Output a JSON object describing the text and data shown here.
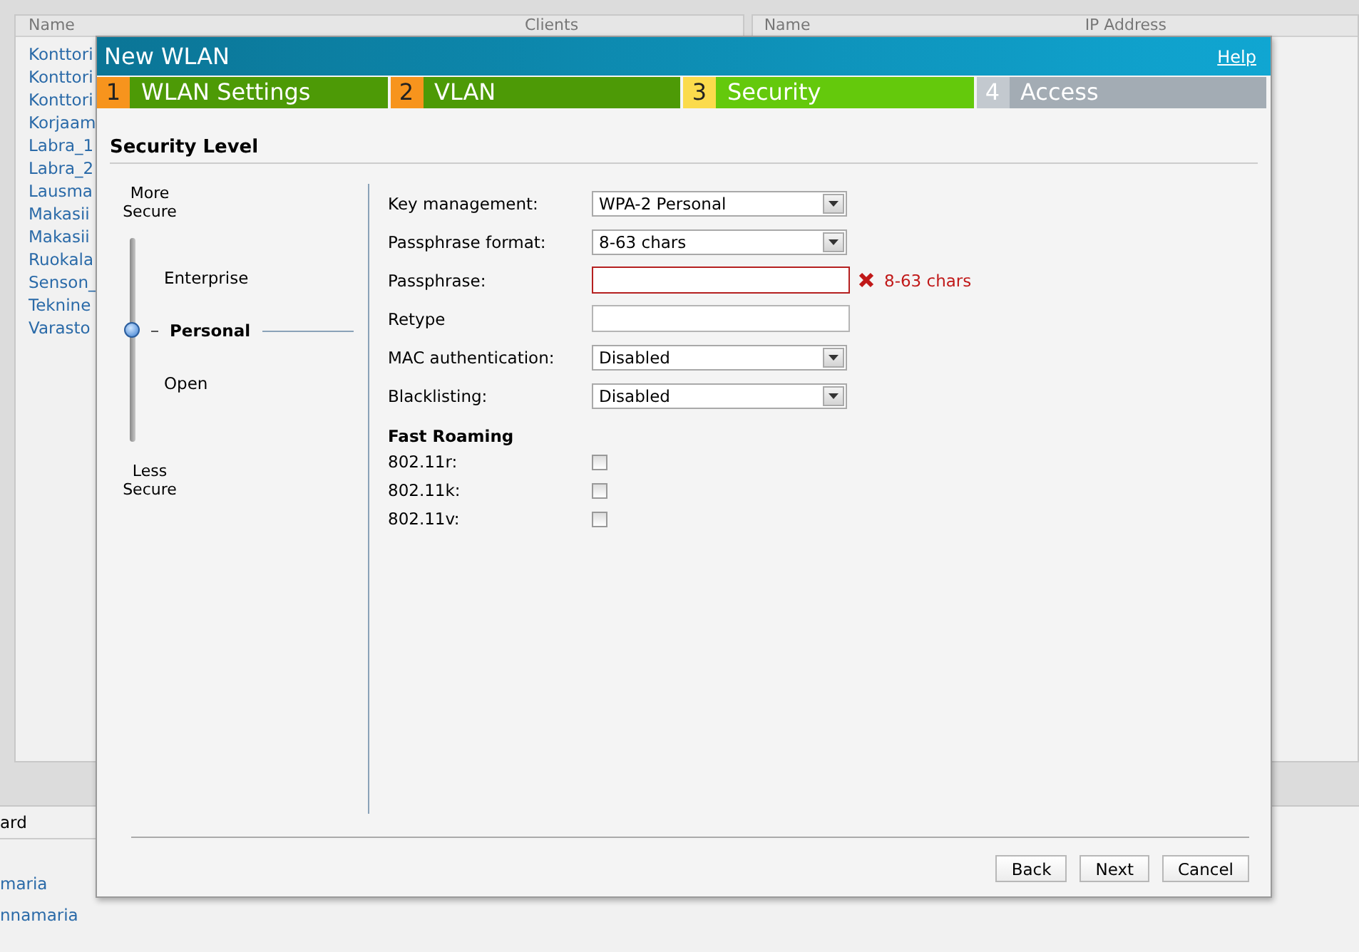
{
  "background": {
    "left_panel": {
      "columns": [
        "Name",
        "Clients"
      ],
      "rows": [
        "Konttori",
        "Konttori",
        "Konttori",
        "Korjaam",
        "Labra_1",
        "Labra_2",
        "Lausma",
        "Makasii",
        "Makasii",
        "Ruokala",
        "Senson_",
        "Teknine",
        "Varasto"
      ]
    },
    "right_panel": {
      "columns": [
        "Name",
        "IP Address"
      ]
    },
    "bottom_panel": {
      "header": "ard",
      "rows": [
        {
          "name": "maria"
        },
        {
          "name": "nnamaria"
        }
      ]
    }
  },
  "dialog": {
    "title": "New WLAN",
    "help": "Help",
    "steps": [
      {
        "number": "1",
        "label": "WLAN Settings",
        "completed": true,
        "selected": false
      },
      {
        "number": "2",
        "label": "VLAN",
        "completed": true,
        "selected": false
      },
      {
        "number": "3",
        "label": "Security",
        "completed": false,
        "selected": true
      },
      {
        "number": "4",
        "label": "Access",
        "completed": false,
        "selected": false
      }
    ],
    "section_title": "Security Level",
    "scale": {
      "top": "More Secure",
      "bottom": "Less Secure",
      "levels": [
        {
          "label": "Enterprise",
          "selected": false
        },
        {
          "label": "Personal",
          "selected": true
        },
        {
          "label": "Open",
          "selected": false
        }
      ]
    },
    "fields": [
      {
        "label": "Key management:",
        "kind": "select",
        "value": "WPA-2 Personal"
      },
      {
        "label": "Passphrase format:",
        "kind": "select",
        "value": "8-63 chars"
      },
      {
        "label": "Passphrase:",
        "kind": "text",
        "error": "8-63 chars"
      },
      {
        "label": "Retype",
        "kind": "text"
      },
      {
        "label": "MAC authentication:",
        "kind": "select",
        "value": "Disabled"
      },
      {
        "label": "Blacklisting:",
        "kind": "select",
        "value": "Disabled"
      }
    ],
    "roaming_title": "Fast Roaming",
    "roaming": [
      {
        "label": "802.11r:",
        "checked": false
      },
      {
        "label": "802.11k:",
        "checked": false
      },
      {
        "label": "802.11v:",
        "checked": false
      }
    ],
    "buttons": [
      "Back",
      "Next",
      "Cancel"
    ]
  }
}
